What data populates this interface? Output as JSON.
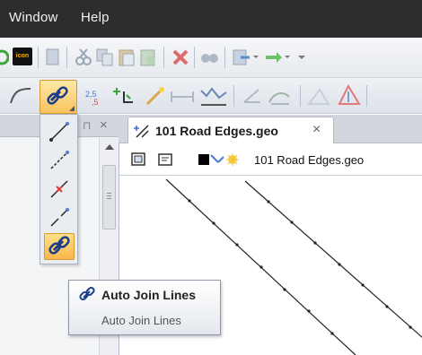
{
  "menu": {
    "items": [
      {
        "label": "Window"
      },
      {
        "label": "Help"
      }
    ]
  },
  "toolbar": {
    "icon_badge": "icon",
    "active_tool": "auto-join-lines"
  },
  "palette": {
    "items": [
      {
        "name": "draw-line"
      },
      {
        "name": "extend-line"
      },
      {
        "name": "break-line"
      },
      {
        "name": "split-line"
      },
      {
        "name": "auto-join-lines",
        "selected": true
      }
    ]
  },
  "document": {
    "tab_title": "101 Road Edges.geo",
    "layer_name": "101 Road Edges.geo",
    "tab_close": "×"
  },
  "left_panel": {
    "pin_glyph": "⊓",
    "close_glyph": "×"
  },
  "tooltip": {
    "title": "Auto Join Lines",
    "description": "Auto Join Lines"
  },
  "colors": {
    "menubar": "#2d2d30",
    "highlight": "#f8c25d",
    "line": "#222222"
  }
}
